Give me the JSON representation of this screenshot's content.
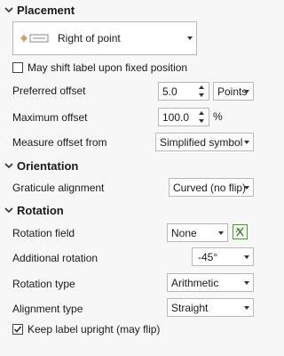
{
  "placement": {
    "header": "Placement",
    "preset_label": "Right of point",
    "shift_label": "May shift label upon fixed position",
    "shift_checked": false,
    "preferred_offset": {
      "label": "Preferred offset",
      "value": "5.0",
      "unit": "Points"
    },
    "maximum_offset": {
      "label": "Maximum offset",
      "value": "100.0",
      "unit": "%"
    },
    "measure_offset": {
      "label": "Measure offset from",
      "value": "Simplified symbol"
    }
  },
  "orientation": {
    "header": "Orientation",
    "graticule": {
      "label": "Graticule alignment",
      "value": "Curved (no flip)"
    }
  },
  "rotation": {
    "header": "Rotation",
    "field": {
      "label": "Rotation field",
      "value": "None"
    },
    "additional": {
      "label": "Additional rotation",
      "value": "-45°"
    },
    "type": {
      "label": "Rotation type",
      "value": "Arithmetic"
    },
    "alignment": {
      "label": "Alignment type",
      "value": "Straight"
    },
    "keep_upright": {
      "label": "Keep label upright (may flip)",
      "checked": true
    }
  }
}
